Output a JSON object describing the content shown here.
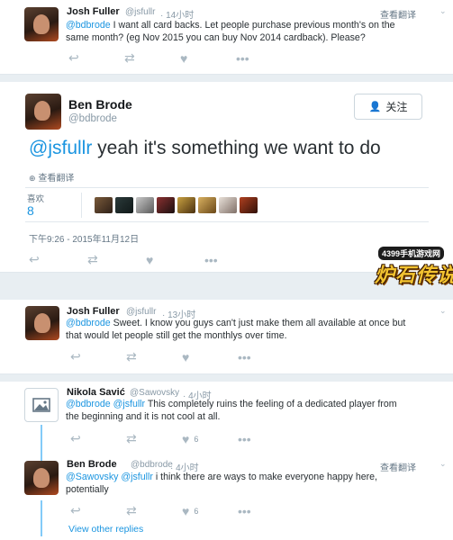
{
  "prev": {
    "name": "Josh Fuller",
    "handle": "@jsfullr",
    "time": "· 14小时",
    "translate": "查看翻译",
    "mention": "@bdbrode",
    "text_line1": " I want all card backs. Let people purchase previous month's on the",
    "text_line2": "same month? (eg Nov 2015 you can buy Nov 2014 cardback). Please?"
  },
  "main": {
    "name": "Ben Brode",
    "handle": "@bdbrode",
    "follow_label": "关注",
    "mention": "@jsfullr",
    "text": " yeah it's something we want to do",
    "translate": "查看翻译",
    "likes_label": "喜欢",
    "likes_count": "8",
    "timestamp": "下午9:26 - 2015年11月12日",
    "liker_count": 8
  },
  "watermark": {
    "top": "4399手机游戏网",
    "main": "炉石传说"
  },
  "reply1": {
    "name": "Josh Fuller",
    "handle": "@jsfullr",
    "time": "· 13小时",
    "mention": "@bdbrode",
    "text_line1": " Sweet. I know you guys can't just make them all available at once but",
    "text_line2": "that would let people still get the monthlys over time."
  },
  "reply2": {
    "name": "Nikola Savić",
    "handle": "@Sawovsky",
    "time": "· 4小时",
    "mention1": "@bdbrode",
    "mention2": "@jsfullr",
    "text_line1": " This completely ruins the feeling of a dedicated player from",
    "text_line2": "the beginning and it is not cool at all.",
    "like_count": "6"
  },
  "reply3": {
    "name": "Ben Brode",
    "handle": "@bdbrode",
    "time": "· 4小时",
    "translate": "查看翻译",
    "mention1": "@Sawovsky",
    "mention2": "@jsfullr",
    "text_line1": " i think there are ways to make everyone happy here,",
    "text_line2": "potentially",
    "like_count": "6"
  },
  "thread": {
    "view_more": "View other replies"
  },
  "colors": {
    "accent": "#1b95e0",
    "muted": "#8899a6",
    "text": "#292f33",
    "divider": "#e1e8ed"
  },
  "icons": [
    "reply-icon",
    "retweet-icon",
    "like-icon",
    "more-icon",
    "globe-icon",
    "follow-person-icon",
    "image-placeholder-icon"
  ]
}
